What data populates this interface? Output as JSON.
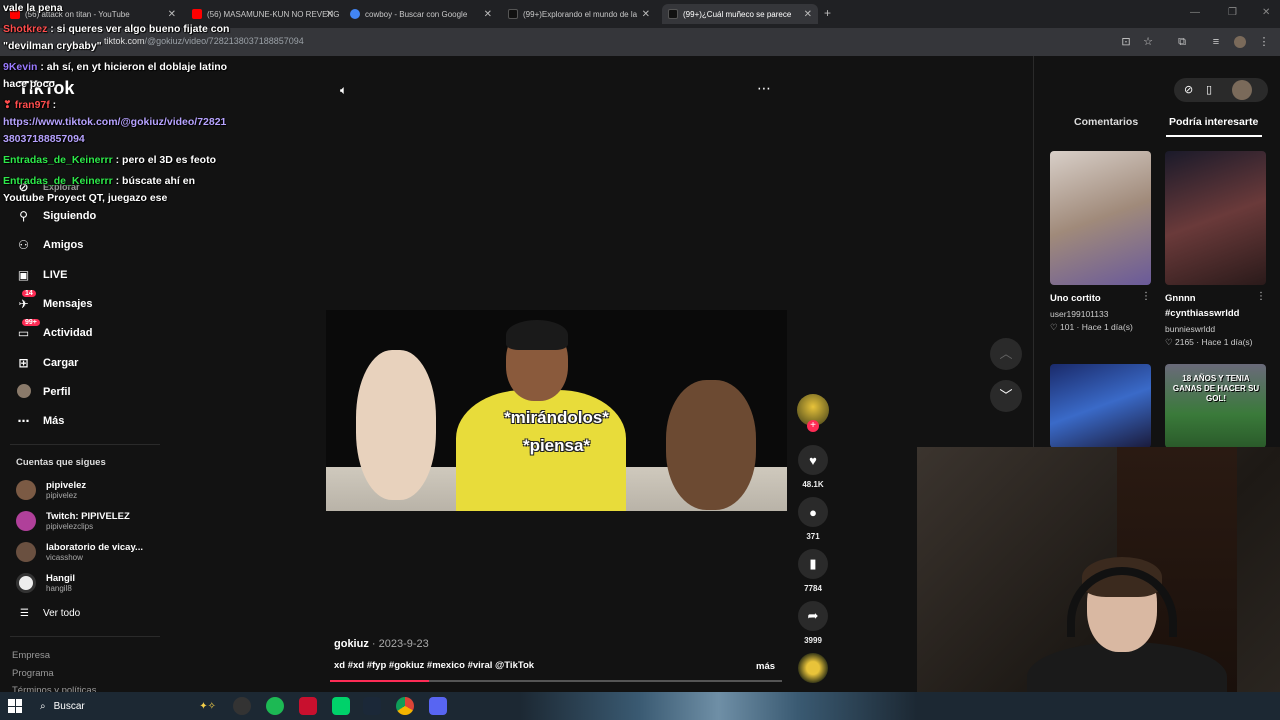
{
  "browser": {
    "tabs": [
      {
        "label": "(56) attack on titan - YouTube",
        "color": "#ff0000"
      },
      {
        "label": "(56) MASAMUNE-KUN NO REVENGE",
        "color": "#ff0000"
      },
      {
        "label": "cowboy - Buscar con Google",
        "color": "#4285f4"
      },
      {
        "label": "(99+)Explorando el mundo de la",
        "color": "#111111"
      },
      {
        "label": "(99+)¿Cuál muñeco se parece",
        "color": "#111111"
      }
    ],
    "url_domain": "tiktok.com",
    "url_path": "/@gokiuz/video/7282138037188857094"
  },
  "tiktok": {
    "logo": "TikTok",
    "nav": [
      {
        "label": "Explorar",
        "icon": "compass-icon",
        "glyph": "⊘"
      },
      {
        "label": "Siguiendo",
        "icon": "following-icon",
        "glyph": "⚲"
      },
      {
        "label": "Amigos",
        "icon": "friends-icon",
        "glyph": "⚇"
      },
      {
        "label": "LIVE",
        "icon": "live-icon",
        "glyph": "▣"
      },
      {
        "label": "Mensajes",
        "icon": "messages-icon",
        "glyph": "✈",
        "badge": "14"
      },
      {
        "label": "Actividad",
        "icon": "activity-icon",
        "glyph": "▭",
        "badge": "99+"
      },
      {
        "label": "Cargar",
        "icon": "upload-icon",
        "glyph": "⊞"
      },
      {
        "label": "Perfil",
        "icon": "profile-icon",
        "glyph": "●"
      },
      {
        "label": "Más",
        "icon": "more-icon",
        "glyph": "⋯"
      }
    ],
    "following_title": "Cuentas que sigues",
    "following": [
      {
        "name": "pipivelez",
        "handle": "pipivelez"
      },
      {
        "name": "Twitch: PIPIVELEZ",
        "handle": "pipivelezclips"
      },
      {
        "name": "laboratorio de vicay...",
        "handle": "vicasshow"
      },
      {
        "name": "Hangil",
        "handle": "hangil8"
      }
    ],
    "see_all": "Ver todo",
    "footer": [
      "Empresa",
      "Programa",
      "Términos y políticas"
    ]
  },
  "video": {
    "caption_line1": "*mirándolos*",
    "caption_line2": "*piensa*",
    "author": "gokiuz",
    "date": "2023-9-23",
    "description": "xd #xd #fyp #gokiuz #mexico #viral @TikTok",
    "more": "más",
    "progress": 0.22,
    "likes": "48.1K",
    "comments": "371",
    "saves": "7784",
    "shares": "3999"
  },
  "right_panel": {
    "tab_comments": "Comentarios",
    "tab_related": "Podría interesarte",
    "cards": [
      {
        "title": "Uno cortito",
        "user": "user199101133",
        "likes": "101",
        "age": "Hace 1 día(s)"
      },
      {
        "title": "Gnnnn #cynthiasswrldd",
        "user": "bunnieswrldd",
        "likes": "2165",
        "age": "Hace 1 día(s)"
      }
    ],
    "thumb_overlay_text": "18 AÑOS Y TENIA GANAS DE HACER SU GOL!"
  },
  "chat": [
    {
      "user": "",
      "text": "vale la pena",
      "color": "#ffffff"
    },
    {
      "user": "Shotkrez",
      "text": ": si queres ver algo bueno fijate con",
      "color": "#ff4d4d"
    },
    {
      "user": "",
      "text": "\"devilman crybaby\"",
      "color": "#ffffff"
    },
    {
      "user": "9Kevin",
      "text": ": ah sí, en yt hicieron el doblaje latino",
      "color": "#9b7bff"
    },
    {
      "user": "",
      "text": "hace poco",
      "color": "#ffffff"
    },
    {
      "user": "fran97f",
      "text": ":",
      "color": "#ff4d4d"
    },
    {
      "user": "",
      "text": "https://www.tiktok.com/@gokiuz/video/72821",
      "color": "#b7a3ff"
    },
    {
      "user": "",
      "text": "38037188857094",
      "color": "#b7a3ff"
    },
    {
      "user": "Entradas_de_Keinerrr",
      "text": ": pero el 3D es feoto",
      "color": "#2ee84a"
    },
    {
      "user": "Entradas_de_Keinerrr",
      "text": ": búscate ahí en",
      "color": "#2ee84a"
    },
    {
      "user": "",
      "text": "Youtube Proyect QT, juegazo ese",
      "color": "#ffffff"
    }
  ],
  "taskbar": {
    "search": "Buscar"
  }
}
